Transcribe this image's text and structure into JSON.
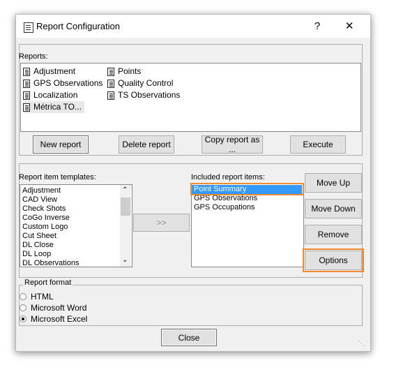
{
  "window": {
    "title": "Report Configuration",
    "help_glyph": "?",
    "close_glyph": "✕"
  },
  "reports": {
    "label": "Reports:",
    "items": [
      "Adjustment",
      "Points",
      "GPS Observations",
      "Quality Control",
      "Localization",
      "TS Observations",
      "Métrica TO..."
    ],
    "selected": "Métrica TO...",
    "buttons": {
      "new": "New report",
      "delete": "Delete report",
      "copy": "Copy report as ...",
      "execute": "Execute"
    }
  },
  "templates": {
    "label": "Report item templates:",
    "items": [
      "Adjustment",
      "CAD View",
      "Check Shots",
      "CoGo Inverse",
      "Custom Logo",
      "Cut Sheet",
      "DL Close",
      "DL Loop",
      "DL Observations"
    ],
    "add_button": ">>"
  },
  "included": {
    "label": "Included report items:",
    "items": [
      "Point Summary",
      "GPS Observations",
      "GPS Occupations"
    ],
    "selected": "Point Summary"
  },
  "side_buttons": {
    "move_up": "Move Up",
    "move_down": "Move Down",
    "remove": "Remove",
    "options": "Options"
  },
  "format": {
    "label": "Report format",
    "options": [
      "HTML",
      "Microsoft Word",
      "Microsoft Excel"
    ],
    "selected": "Microsoft Excel"
  },
  "close_button": "Close",
  "colors": {
    "highlight": "#f08a2c",
    "selection": "#3399ff"
  }
}
